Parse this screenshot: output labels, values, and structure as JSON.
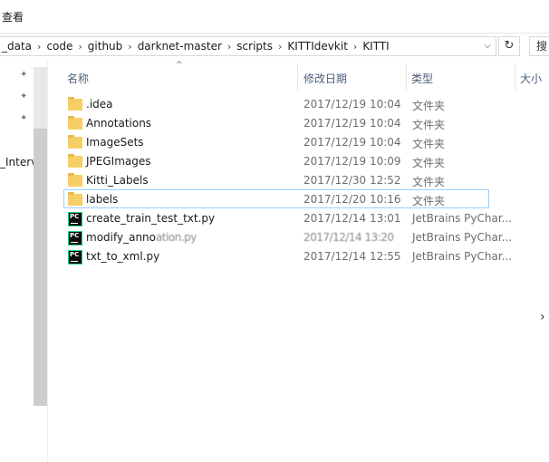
{
  "ribbon": {
    "view_tab": "查看"
  },
  "address": {
    "crumbs": [
      "_data",
      "code",
      "github",
      "darknet-master",
      "scripts",
      "KITTIdevkit",
      "KITTI"
    ],
    "dropdown_glyph": "⌵",
    "refresh_glyph": "↻",
    "search_placeholder": "搜"
  },
  "nav": {
    "partial_item": "_Interv"
  },
  "columns": {
    "name": "名称",
    "date": "修改日期",
    "type": "类型",
    "size": "大小",
    "sort_glyph": "^"
  },
  "files": [
    {
      "name": ".idea",
      "date": "2017/12/19 10:04",
      "type": "文件夹",
      "icon": "folder-icon"
    },
    {
      "name": "Annotations",
      "date": "2017/12/19 10:04",
      "type": "文件夹",
      "icon": "folder-icon"
    },
    {
      "name": "ImageSets",
      "date": "2017/12/19 10:04",
      "type": "文件夹",
      "icon": "folder-icon"
    },
    {
      "name": "JPEGImages",
      "date": "2017/12/19 10:09",
      "type": "文件夹",
      "icon": "folder-icon"
    },
    {
      "name": "Kitti_Labels",
      "date": "2017/12/30 12:52",
      "type": "文件夹",
      "icon": "folder-icon"
    },
    {
      "name": "labels",
      "date": "2017/12/20 10:16",
      "type": "文件夹",
      "icon": "folder-icon",
      "selected": true
    },
    {
      "name": "create_train_test_txt.py",
      "date": "2017/12/14 13:01",
      "type": "JetBrains PyChar...",
      "icon": "pycharm-file-icon"
    },
    {
      "name": "modify_anno",
      "name_obscured": "ation.py",
      "date": "2017/12/14 13:20",
      "type": "JetBrains PyChar...",
      "icon": "pycharm-file-icon"
    },
    {
      "name": "txt_to_xml.py",
      "date": "2017/12/14 12:55",
      "type": "JetBrains PyChar...",
      "icon": "pycharm-file-icon"
    }
  ],
  "scroll_arrow_glyph": "›"
}
